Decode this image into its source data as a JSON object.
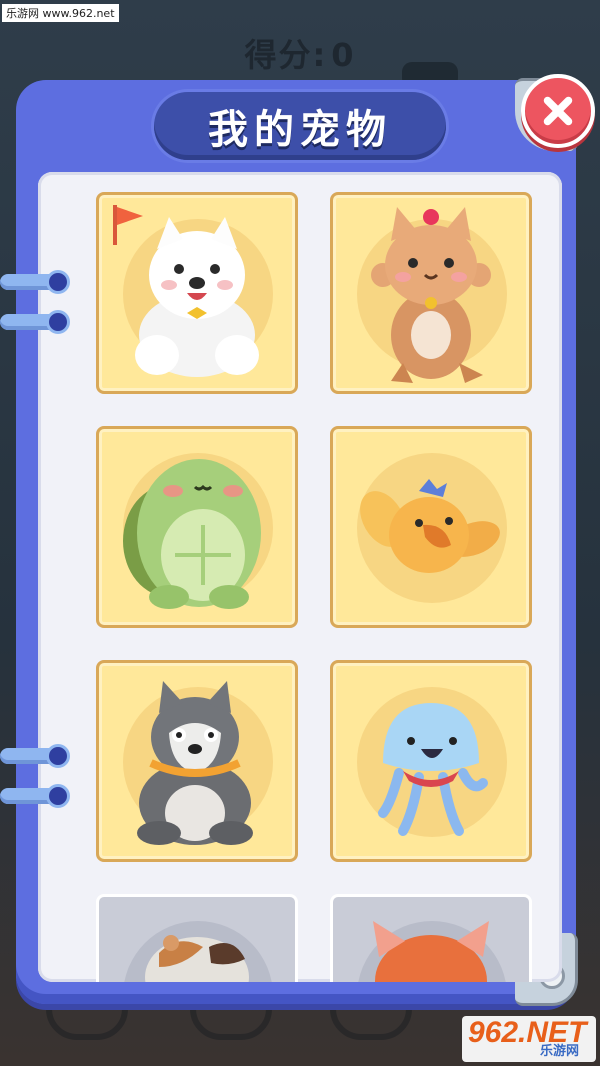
{
  "watermark_top": "乐游网 www.962.net",
  "hud": {
    "score_label": "得分:",
    "score_value": "0"
  },
  "dialog": {
    "title": "我的宠物",
    "close_icon": "close-icon",
    "colors": {
      "panel": "#5d6ee0",
      "title_plate": "#3d4fa9",
      "close": "#ed5560",
      "card": "#ffe89a",
      "locked_card": "#c9ccd7"
    }
  },
  "pets": [
    {
      "name": "samoyed",
      "selected": true,
      "locked": false
    },
    {
      "name": "kitten",
      "selected": false,
      "locked": false
    },
    {
      "name": "turtle",
      "selected": false,
      "locked": false
    },
    {
      "name": "bird",
      "selected": false,
      "locked": false
    },
    {
      "name": "husky",
      "selected": false,
      "locked": false
    },
    {
      "name": "jellyfish",
      "selected": false,
      "locked": false
    },
    {
      "name": "hamster",
      "selected": false,
      "locked": true
    },
    {
      "name": "fox",
      "selected": false,
      "locked": true
    }
  ],
  "logo": {
    "big": "962.NET",
    "small": "乐游网"
  }
}
